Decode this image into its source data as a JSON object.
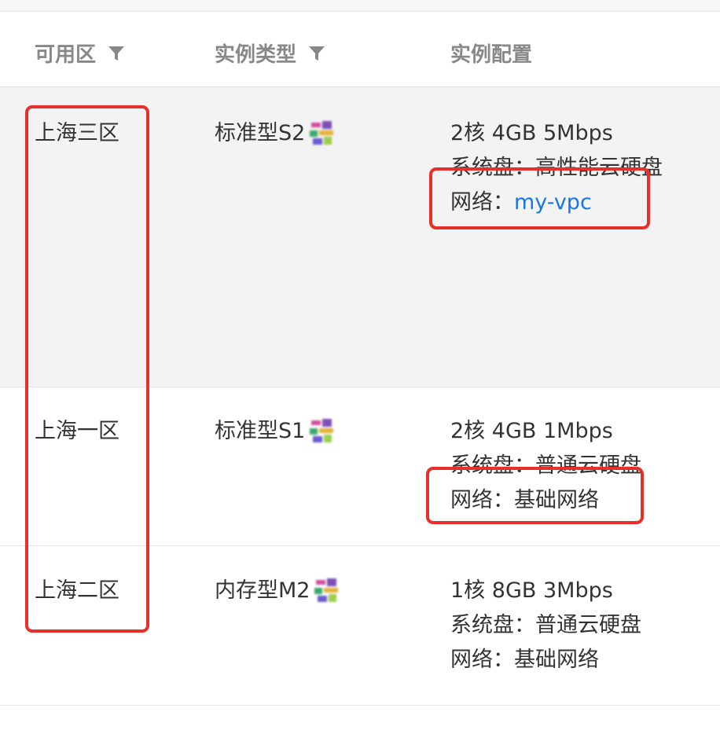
{
  "columns": {
    "zone": "可用区",
    "type": "实例类型",
    "config": "实例配置"
  },
  "rows": [
    {
      "zone": "上海三区",
      "type": "标准型S2",
      "spec": "2核 4GB 5Mbps",
      "disk_label": "系统盘：",
      "disk": "高性能云硬盘",
      "network_label": "网络：",
      "network": "my-vpc"
    },
    {
      "zone": "上海一区",
      "type": "标准型S1",
      "spec": "2核 4GB 1Mbps",
      "disk_label": "系统盘：",
      "disk": "普通云硬盘",
      "network_label": "网络：",
      "network": "基础网络"
    },
    {
      "zone": "上海二区",
      "type": "内存型M2",
      "spec": "1核 8GB 3Mbps",
      "disk_label": "系统盘：",
      "disk": "普通云硬盘",
      "network_label": "网络：",
      "network": "基础网络"
    }
  ],
  "colors": {
    "link": "#1677e6",
    "annotation": "#e8302a",
    "highlight_row": "#f3f3f3"
  },
  "icons": [
    "filter-icon",
    "instance-type-badge-icon"
  ]
}
